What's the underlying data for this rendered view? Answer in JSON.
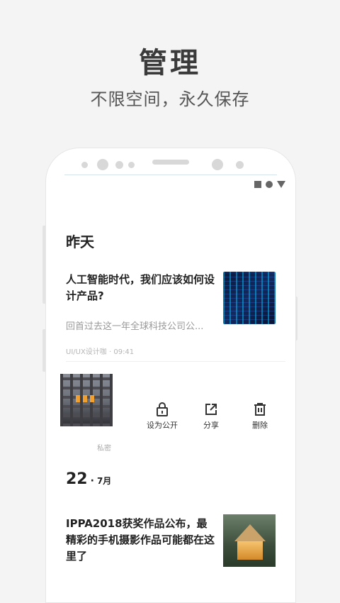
{
  "header": {
    "title": "管理",
    "subtitle": "不限空间，永久保存"
  },
  "feed": {
    "section_label": "昨天",
    "article1": {
      "title": "人工智能时代，我们应该如何设计产品?",
      "excerpt": "回首过去这一年全球科技公司公...",
      "meta": "UI/UX设计咖 · 09:41"
    },
    "item2": {
      "privacy_label": "私密",
      "actions": {
        "set_public": "设为公开",
        "share": "分享",
        "delete": "删除"
      }
    },
    "date_group": {
      "day": "22",
      "sep": "·",
      "month": "7月"
    },
    "article2": {
      "title": "IPPA2018获奖作品公布，最精彩的手机摄影作品可能都在这里了"
    }
  },
  "icons": {
    "status": [
      "square-icon",
      "circle-icon",
      "triangle-icon"
    ],
    "actions": [
      "lock-icon",
      "share-icon",
      "trash-icon"
    ]
  },
  "colors": {
    "background": "#f4f4f4",
    "text_primary": "#222222",
    "text_secondary": "#999999"
  }
}
